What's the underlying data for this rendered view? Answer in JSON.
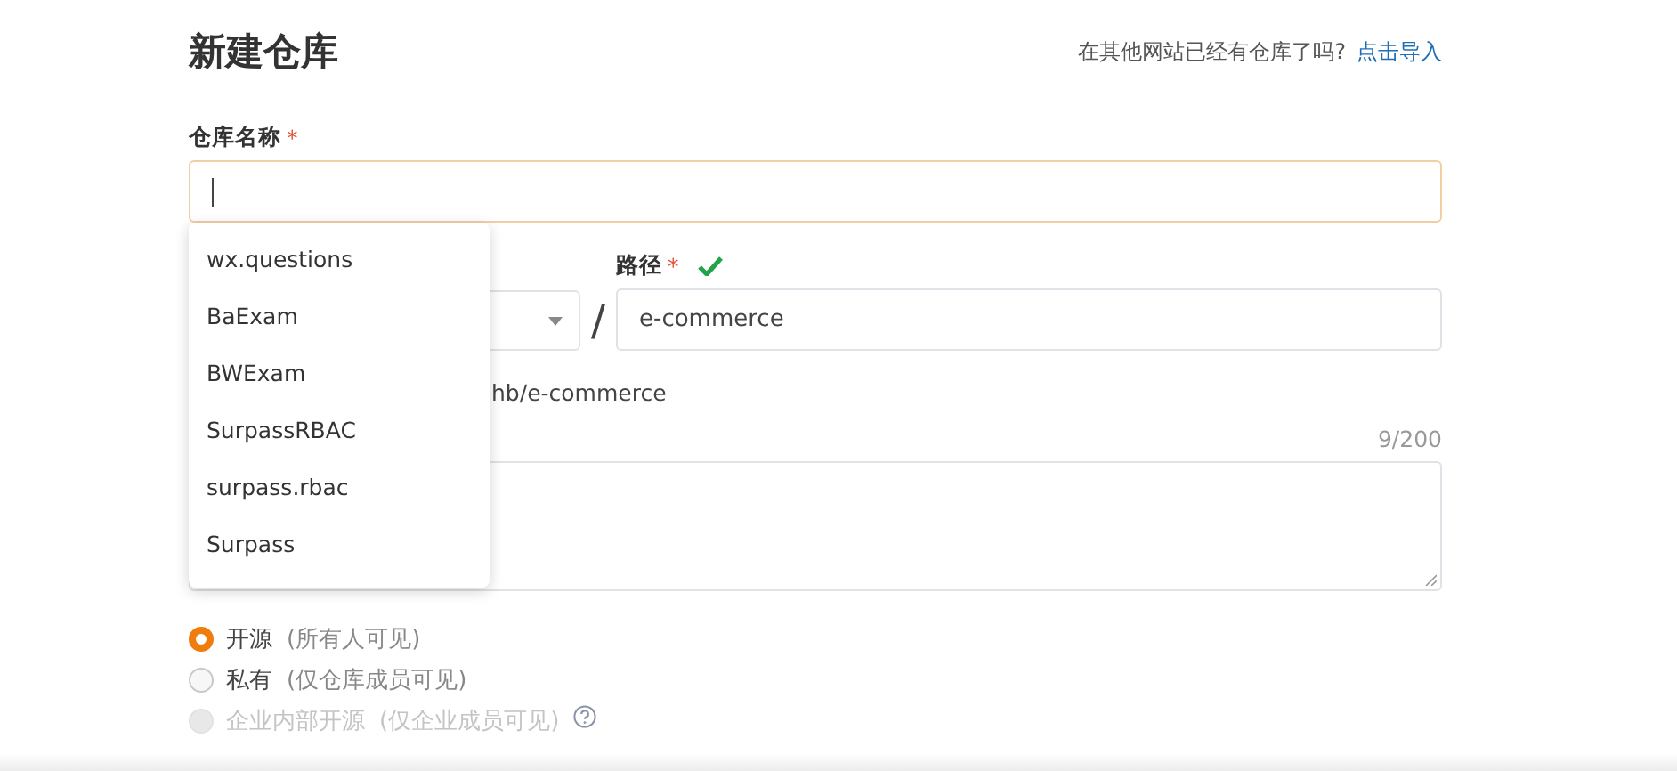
{
  "page": {
    "title": "新建仓库",
    "import_prompt": "在其他网站已经有仓库了吗?",
    "import_link": "点击导入"
  },
  "name_field": {
    "label": "仓库名称",
    "required_mark": "*",
    "focused": true
  },
  "suggestions": [
    "wx.questions",
    "BaExam",
    "BWExam",
    "SurpassRBAC",
    "surpass.rbac",
    "Surpass"
  ],
  "path_field": {
    "label": "路径",
    "required_mark": "*",
    "valid": true,
    "separator": "/",
    "value": "e-commerce"
  },
  "path_hint": "hb/e-commerce",
  "description": {
    "counter": "9/200"
  },
  "visibility": [
    {
      "label": "开源",
      "note": "(所有人可见)",
      "selected": true,
      "disabled": false,
      "help": false
    },
    {
      "label": "私有",
      "note": "(仅仓库成员可见)",
      "selected": false,
      "disabled": false,
      "help": false
    },
    {
      "label": "企业内部开源",
      "note": "(仅企业成员可见)",
      "selected": false,
      "disabled": true,
      "help": true
    }
  ]
}
